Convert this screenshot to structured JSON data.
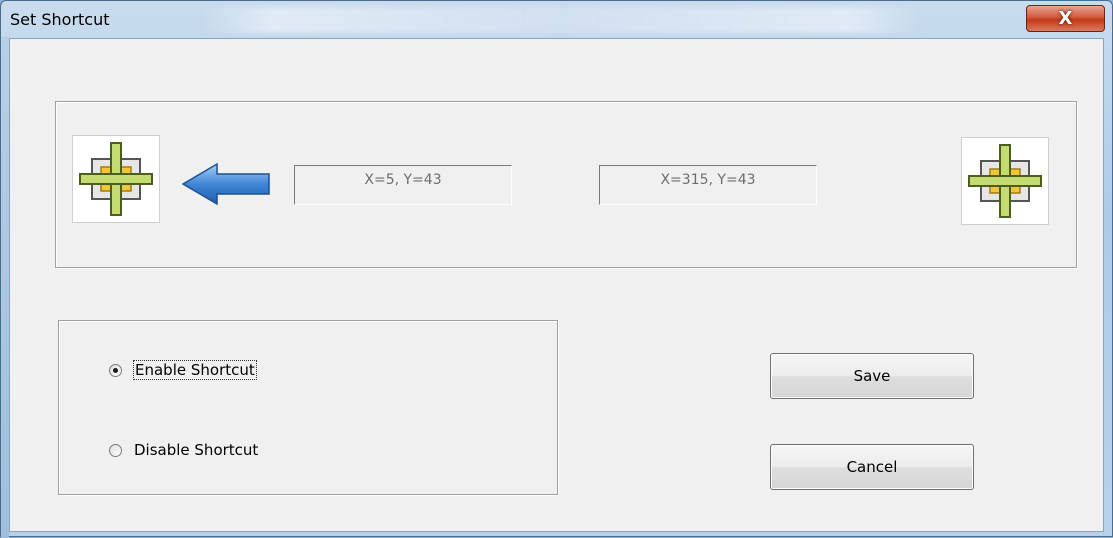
{
  "window": {
    "title": "Set Shortcut",
    "close_label": "X"
  },
  "points": {
    "left_icon": "crosshair-target-icon",
    "arrow_icon": "arrow-left-icon",
    "right_icon": "crosshair-target-icon",
    "start_coord": "X=5, Y=43",
    "end_coord": "X=315, Y=43"
  },
  "options": {
    "enable_label": "Enable Shortcut",
    "disable_label": "Disable Shortcut",
    "selected": "enable"
  },
  "actions": {
    "save_label": "Save",
    "cancel_label": "Cancel"
  },
  "colors": {
    "close_button": "#c43a18",
    "arrow": "#3a7fd0",
    "crosshair": "#b8d36a",
    "crosshair_center": "#f0c020"
  }
}
